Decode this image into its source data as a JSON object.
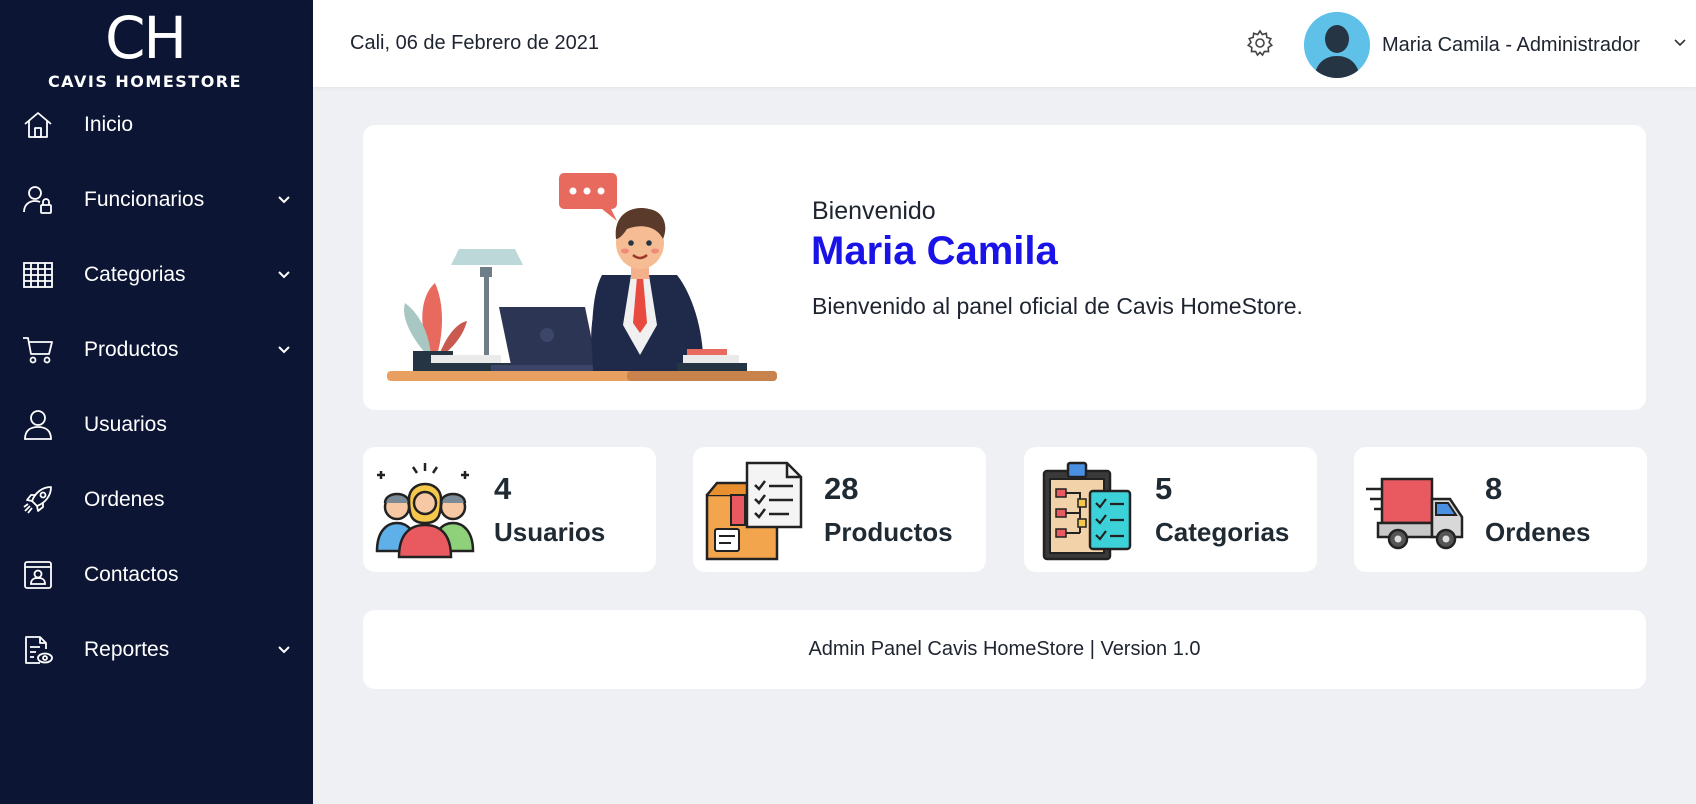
{
  "brand": {
    "mark": "CH",
    "name": "CAVIS HOMESTORE"
  },
  "sidebar": {
    "items": [
      {
        "label": "Inicio",
        "icon": "home-icon",
        "has_submenu": false
      },
      {
        "label": "Funcionarios",
        "icon": "user-lock-icon",
        "has_submenu": true
      },
      {
        "label": "Categorias",
        "icon": "grid-icon",
        "has_submenu": true
      },
      {
        "label": "Productos",
        "icon": "cart-icon",
        "has_submenu": true
      },
      {
        "label": "Usuarios",
        "icon": "user-icon",
        "has_submenu": false
      },
      {
        "label": "Ordenes",
        "icon": "rocket-icon",
        "has_submenu": false
      },
      {
        "label": "Contactos",
        "icon": "contact-card-icon",
        "has_submenu": false
      },
      {
        "label": "Reportes",
        "icon": "report-icon",
        "has_submenu": true
      }
    ]
  },
  "header": {
    "date": "Cali, 06 de Febrero de 2021",
    "user": "Maria Camila - Administrador"
  },
  "welcome": {
    "greeting": "Bienvenido",
    "name": "Maria Camila",
    "description": "Bienvenido al panel oficial de Cavis HomeStore."
  },
  "stats": [
    {
      "value": "4",
      "label": "Usuarios",
      "icon": "users-group-icon"
    },
    {
      "value": "28",
      "label": "Productos",
      "icon": "product-box-icon"
    },
    {
      "value": "5",
      "label": "Categorias",
      "icon": "clipboard-icon"
    },
    {
      "value": "8",
      "label": "Ordenes",
      "icon": "delivery-truck-icon"
    }
  ],
  "footer": {
    "text": "Admin Panel Cavis HomeStore | Version 1.0"
  },
  "colors": {
    "sidebar": "#0c1533",
    "accent": "#1a13e8",
    "background": "#eef0f4"
  }
}
